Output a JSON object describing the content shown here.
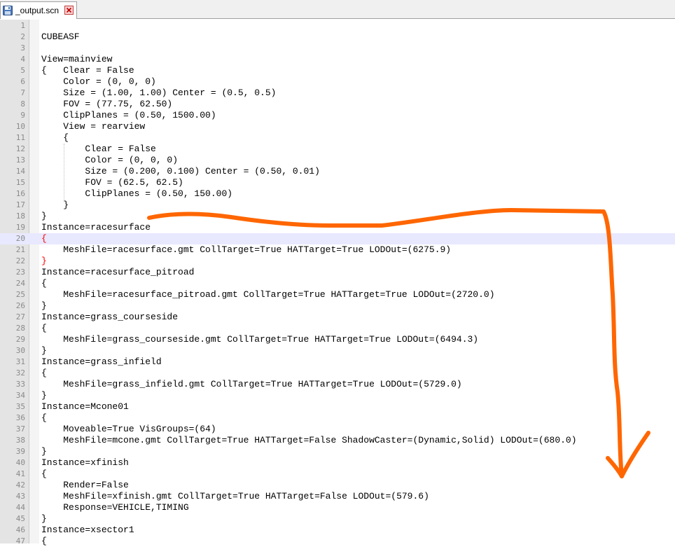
{
  "tab": {
    "title": "_output.scn",
    "icon": "floppy-save-icon",
    "close_icon": "close-icon"
  },
  "editor": {
    "lines": [
      {
        "num": "1",
        "text": ""
      },
      {
        "num": "2",
        "text": "CUBEASF"
      },
      {
        "num": "3",
        "text": ""
      },
      {
        "num": "4",
        "text": "View=mainview"
      },
      {
        "num": "5",
        "text": "{   Clear = False"
      },
      {
        "num": "6",
        "text": "    Color = (0, 0, 0)"
      },
      {
        "num": "7",
        "text": "    Size = (1.00, 1.00) Center = (0.5, 0.5)"
      },
      {
        "num": "8",
        "text": "    FOV = (77.75, 62.50)"
      },
      {
        "num": "9",
        "text": "    ClipPlanes = (0.50, 1500.00)"
      },
      {
        "num": "10",
        "text": "    View = rearview"
      },
      {
        "num": "11",
        "text": "    {"
      },
      {
        "num": "12",
        "text": "        Clear = False"
      },
      {
        "num": "13",
        "text": "        Color = (0, 0, 0)"
      },
      {
        "num": "14",
        "text": "        Size = (0.200, 0.100) Center = (0.50, 0.01)"
      },
      {
        "num": "15",
        "text": "        FOV = (62.5, 62.5)"
      },
      {
        "num": "16",
        "text": "        ClipPlanes = (0.50, 150.00)"
      },
      {
        "num": "17",
        "text": "    }"
      },
      {
        "num": "18",
        "text": "}"
      },
      {
        "num": "19",
        "text": "Instance=racesurface"
      },
      {
        "num": "20",
        "text": "{"
      },
      {
        "num": "21",
        "text": "    MeshFile=racesurface.gmt CollTarget=True HATTarget=True LODOut=(6275.9)"
      },
      {
        "num": "22",
        "text": "}"
      },
      {
        "num": "23",
        "text": "Instance=racesurface_pitroad"
      },
      {
        "num": "24",
        "text": "{"
      },
      {
        "num": "25",
        "text": "    MeshFile=racesurface_pitroad.gmt CollTarget=True HATTarget=True LODOut=(2720.0)"
      },
      {
        "num": "26",
        "text": "}"
      },
      {
        "num": "27",
        "text": "Instance=grass_courseside"
      },
      {
        "num": "28",
        "text": "{"
      },
      {
        "num": "29",
        "text": "    MeshFile=grass_courseside.gmt CollTarget=True HATTarget=True LODOut=(6494.3)"
      },
      {
        "num": "30",
        "text": "}"
      },
      {
        "num": "31",
        "text": "Instance=grass_infield"
      },
      {
        "num": "32",
        "text": "{"
      },
      {
        "num": "33",
        "text": "    MeshFile=grass_infield.gmt CollTarget=True HATTarget=True LODOut=(5729.0)"
      },
      {
        "num": "34",
        "text": "}"
      },
      {
        "num": "35",
        "text": "Instance=Mcone01"
      },
      {
        "num": "36",
        "text": "{"
      },
      {
        "num": "37",
        "text": "    Moveable=True VisGroups=(64)"
      },
      {
        "num": "38",
        "text": "    MeshFile=mcone.gmt CollTarget=True HATTarget=False ShadowCaster=(Dynamic,Solid) LODOut=(680.0)"
      },
      {
        "num": "39",
        "text": "}"
      },
      {
        "num": "40",
        "text": "Instance=xfinish"
      },
      {
        "num": "41",
        "text": "{"
      },
      {
        "num": "42",
        "text": "    Render=False"
      },
      {
        "num": "43",
        "text": "    MeshFile=xfinish.gmt CollTarget=True HATTarget=False LODOut=(579.6)"
      },
      {
        "num": "44",
        "text": "    Response=VEHICLE,TIMING"
      },
      {
        "num": "45",
        "text": "}"
      },
      {
        "num": "46",
        "text": "Instance=xsector1"
      },
      {
        "num": "47",
        "text": "{"
      }
    ]
  },
  "colors": {
    "current_line": "#e8e8ff",
    "brace_highlight": "#ff0000",
    "annotation_arrow": "#ff6600"
  }
}
